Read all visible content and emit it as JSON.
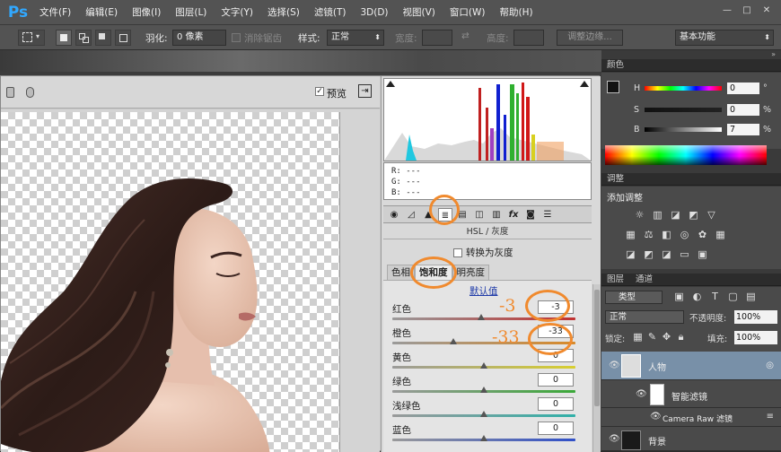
{
  "app": {
    "logo": "Ps"
  },
  "menu": [
    "文件(F)",
    "编辑(E)",
    "图像(I)",
    "图层(L)",
    "文字(Y)",
    "选择(S)",
    "滤镜(T)",
    "3D(D)",
    "视图(V)",
    "窗口(W)",
    "帮助(H)"
  ],
  "window_controls": [
    "—",
    "□",
    "✕"
  ],
  "options": {
    "feather_label": "羽化:",
    "feather_value": "0 像素",
    "antialias_label": "消除锯齿",
    "style_label": "样式:",
    "style_value": "正常",
    "width_label": "宽度:",
    "height_label": "高度:",
    "refine_edge": "调整边缘...",
    "workspace": "基本功能"
  },
  "dialog": {
    "preview_label": "预览",
    "rgb_readout": {
      "r": "R:  ---",
      "g": "G:  ---",
      "b": "B:  ---"
    },
    "section_title": "HSL / 灰度",
    "convert_gray": "转换为灰度",
    "subtabs": [
      "色相",
      "饱和度",
      "明亮度"
    ],
    "default_link": "默认值",
    "sliders": [
      {
        "label": "红色",
        "value": "-3",
        "position": 0.485,
        "gradient": "linear-gradient(90deg,#9a9a9a,#c03030)"
      },
      {
        "label": "橙色",
        "value": "-33",
        "position": 0.335,
        "gradient": "linear-gradient(90deg,#9a9a9a,#d88a2a)"
      },
      {
        "label": "黄色",
        "value": "0",
        "position": 0.5,
        "gradient": "linear-gradient(90deg,#9a9a9a,#d8cf30)"
      },
      {
        "label": "绿色",
        "value": "0",
        "position": 0.5,
        "gradient": "linear-gradient(90deg,#9a9a9a,#3aa838)"
      },
      {
        "label": "浅绿色",
        "value": "0",
        "position": 0.5,
        "gradient": "linear-gradient(90deg,#9a9a9a,#30b0a8)"
      },
      {
        "label": "蓝色",
        "value": "0",
        "position": 0.5,
        "gradient": "linear-gradient(90deg,#9a9a9a,#3050c8)"
      }
    ]
  },
  "annotations": {
    "red_value": "-3",
    "orange_value": "-33"
  },
  "color_panel": {
    "tab": "颜色",
    "h_label": "H",
    "h_value": "0",
    "h_unit": "°",
    "s_label": "S",
    "s_value": "0",
    "s_unit": "%",
    "b_label": "B",
    "b_value": "7",
    "b_unit": "%"
  },
  "adjust_panel": {
    "tab": "调整",
    "title": "添加调整"
  },
  "layers_panel": {
    "tabs": [
      "图层",
      "通道"
    ],
    "kind_label": "类型",
    "blend_mode": "正常",
    "opacity_label": "不透明度:",
    "opacity_value": "100%",
    "lock_label": "锁定:",
    "fill_label": "填充:",
    "fill_value": "100%",
    "layers": [
      {
        "name": "人物"
      },
      {
        "name": "智能滤镜"
      },
      {
        "name": "Camera Raw 滤镜"
      },
      {
        "name": "背景"
      }
    ]
  },
  "colors": {
    "accent_annotation": "#f08a2e",
    "ps_blue": "#31a8ff"
  }
}
